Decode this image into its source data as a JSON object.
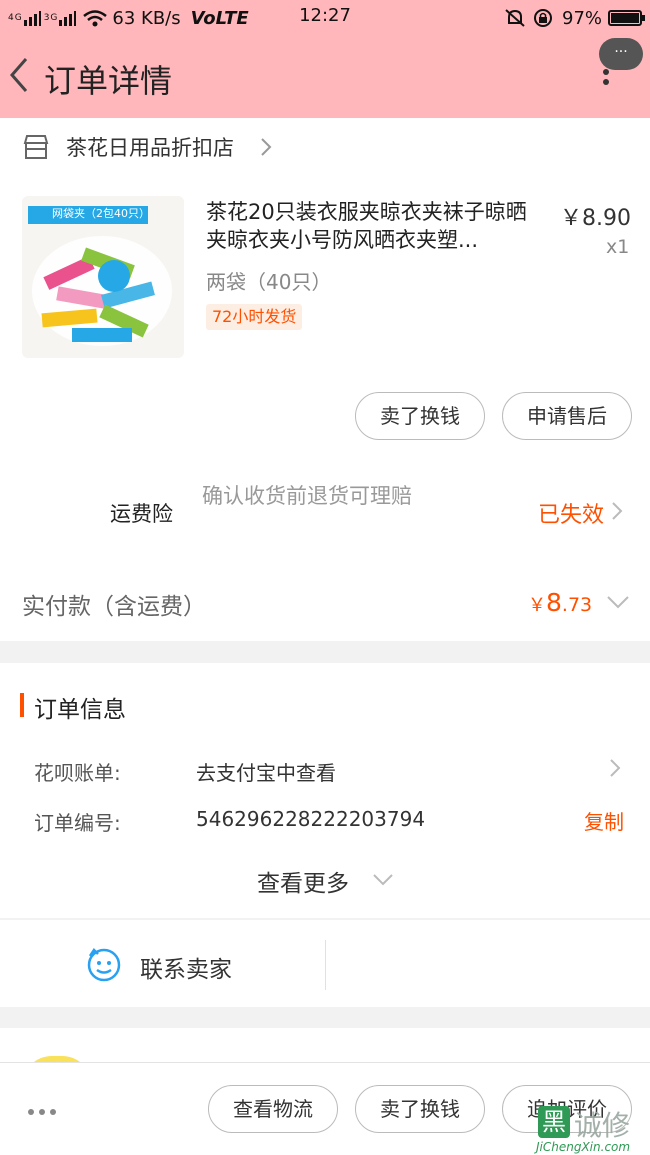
{
  "status_bar": {
    "signal1": "4G",
    "signal2": "3G",
    "speed": "63 KB/s",
    "volte": "VoLTE",
    "time": "12:27",
    "battery": "97%"
  },
  "header": {
    "title": "订单详情",
    "bubble": "···"
  },
  "store": {
    "name": "茶花日用品折扣店"
  },
  "product": {
    "name": "茶花20只装衣服夹晾衣夹袜子晾晒夹晾衣夹小号防风晒衣夹塑...",
    "price": "￥8.90",
    "quantity": "x1",
    "sku": "两袋（40只）",
    "tag": "72小时发货",
    "image_caption": "网袋夹（2包40只）"
  },
  "item_actions": {
    "sell_label": "卖了换钱",
    "after_sale_label": "申请售后"
  },
  "insurance": {
    "label": "运费险",
    "desc": "确认收货前退货可理赔",
    "status": "已失效"
  },
  "payment": {
    "label": "实付款（含运费）",
    "currency": "￥",
    "amount_int": "8",
    "amount_dec": ".73"
  },
  "order_info": {
    "title": "订单信息",
    "rows": [
      {
        "label": "花呗账单:",
        "value": "去支付宝中查看"
      },
      {
        "label": "订单编号:",
        "value": "546296228222203794"
      }
    ],
    "copy_label": "复制",
    "more_label": "查看更多"
  },
  "contact": {
    "label": "联系卖家"
  },
  "bottom_bar": {
    "logistics_label": "查看物流",
    "sell_label": "卖了换钱",
    "review_label": "追加评价"
  },
  "watermark": {
    "logo": "黑",
    "cn": "诚修",
    "en": "JiChengXin.com"
  },
  "colors": {
    "header_bg": "#ffb7bb",
    "accent": "#ff5000",
    "watermark_green": "#2f9a55"
  }
}
